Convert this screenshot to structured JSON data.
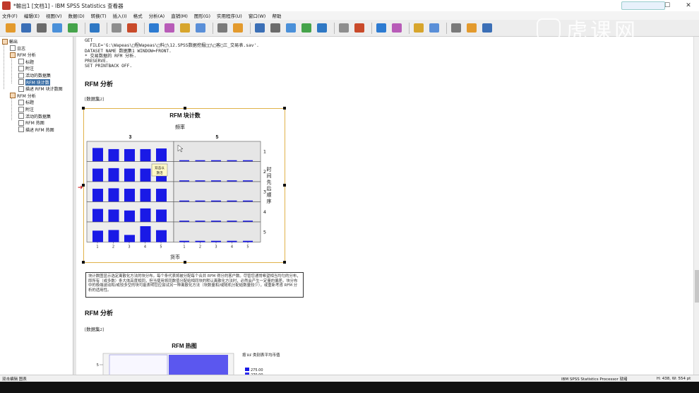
{
  "window": {
    "title": "*輸出1 [文档1] - IBM SPSS Statistics 查看器",
    "minimize": "—",
    "maximize": "☐",
    "close": "✕"
  },
  "menu": [
    "文件(F)",
    "编辑(E)",
    "视图(V)",
    "数据(D)",
    "转换(T)",
    "插入(I)",
    "格式",
    "分析(A)",
    "直销(M)",
    "图形(G)",
    "实用程序(U)",
    "窗口(W)",
    "帮助"
  ],
  "toolbar_icons": [
    "open-icon",
    "save-icon",
    "print-icon",
    "print-preview-icon",
    "export-icon",
    "sep",
    "recall-dialog-icon",
    "sep",
    "undo-icon",
    "redo-icon",
    "sep",
    "goto-data-icon",
    "goto-case-icon",
    "goto-variable-icon",
    "variables-icon",
    "sep",
    "find-icon",
    "replace-icon",
    "sep",
    "insert-heading-icon",
    "insert-title-icon",
    "insert-text-icon",
    "insert-image-icon",
    "insert-object-icon",
    "sep",
    "previous-icon",
    "next-icon",
    "sep",
    "expand-icon",
    "collapse-icon",
    "sep",
    "show-icon",
    "hide-icon",
    "sep",
    "designate-window-icon",
    "new-window-icon",
    "split-window-icon"
  ],
  "watermark": "虎课网",
  "outline": [
    {
      "label": "輸出",
      "icon": "book"
    },
    {
      "label": "日志",
      "icon": "doc"
    },
    {
      "label": "RFM 分析",
      "icon": "book"
    },
    {
      "label": "标题",
      "icon": "doc"
    },
    {
      "label": "附注",
      "icon": "doc"
    },
    {
      "label": "活动的数据集",
      "icon": "doc"
    },
    {
      "label": "RFM 块计数",
      "icon": "chart",
      "selected": true
    },
    {
      "label": "描述 RFM 块计数图",
      "icon": "doc"
    },
    {
      "label": "RFM 分析",
      "icon": "book"
    },
    {
      "label": "标题",
      "icon": "doc"
    },
    {
      "label": "附注",
      "icon": "doc"
    },
    {
      "label": "活动的数据集",
      "icon": "doc"
    },
    {
      "label": "RFM 热图",
      "icon": "chart"
    },
    {
      "label": "描述 RFM 热图",
      "icon": "doc"
    }
  ],
  "syntax": "GET\n  FILE='G:\\Wapeas\\□程Wapeas\\□料□\\12.SPSS数据挖掘□□\\□客□三_交易表.sav'.\nDATASET NAME 数据集1 WINDOW=FRONT.\n* 交易数据的 RFM 分析.\nPRESERVE.\nSET PRINTBACK OFF.",
  "section1": {
    "heading": "RFM 分析",
    "dataset": "[数据集2]"
  },
  "chart_data": {
    "type": "bar",
    "title": "RFM 块计数",
    "top_label": "频率",
    "right_label": "时间先后顺序",
    "bottom_label": "货币",
    "columns": [
      "3",
      "5"
    ],
    "rows": [
      "1",
      "2",
      "3",
      "4",
      "5"
    ],
    "x_ticks": [
      "1",
      "2",
      "3",
      "4",
      "5"
    ],
    "panels": [
      [
        [
          0.85,
          0.78,
          0.78,
          0.78,
          0.82
        ],
        [
          0.08,
          0.08,
          0.08,
          0.08,
          0.08
        ]
      ],
      [
        [
          0.82,
          0.85,
          0.82,
          0.82,
          0.82
        ],
        [
          0.08,
          0.08,
          0.08,
          0.08,
          0.08
        ]
      ],
      [
        [
          0.82,
          0.85,
          0.82,
          0.82,
          0.82
        ],
        [
          0.08,
          0.08,
          0.08,
          0.08,
          0.08
        ]
      ],
      [
        [
          0.82,
          0.78,
          0.72,
          0.85,
          0.78
        ],
        [
          0.08,
          0.08,
          0.08,
          0.08,
          0.08
        ]
      ],
      [
        [
          0.72,
          0.76,
          0.45,
          1.0,
          0.75
        ],
        [
          0.08,
          0.08,
          0.08,
          0.08,
          0.08
        ]
      ]
    ],
    "bar_color": "#1a1ae6",
    "tooltip": "双击以激活"
  },
  "note": "块计数图显示选定离散化方法的块分布。每个条代表将被分配每个合并 RFM 得分的客户数。尽管您通常希望相当均匀的分布，即所有（或多数）条大体高度相同，但当使用将同数值分配给相同块的默认离散化方法时，必然会产生一定量的偏差。块分布中的极端波动和/或较多空的块可能表明您应尝试另一种离散化方法（块数量和/或随机分配结数量较少），或重新考虑 RFM 分析的适用性。",
  "section2": {
    "heading": "RFM 分析",
    "dataset": "[数据集2]"
  },
  "heatmap": {
    "title": "RFM 热图",
    "legend_title": "按 RF 类别表平均币值",
    "legend_values": [
      "275.00",
      "270.00"
    ],
    "y_tick": "5"
  },
  "status": {
    "left": "双击编辑 图表",
    "processor": "IBM SPSS Statistics Processor 就绪",
    "dims": "H: 438, W: 554 pt"
  }
}
